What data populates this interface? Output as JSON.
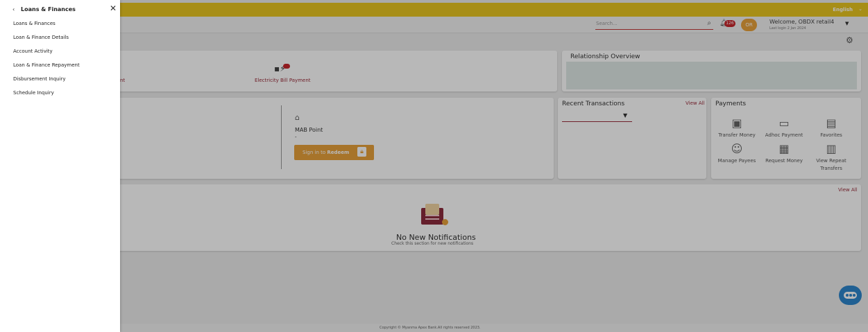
{
  "topbar": {
    "language": "English",
    "language_caret": "⌄"
  },
  "header": {
    "search_placeholder": "Search...",
    "notifications_count": "126",
    "avatar_initials": "OR",
    "welcome": "Welcome, OBDX retail4",
    "last_login": "Last login 2 Jan 2024"
  },
  "quick_access": {
    "partial_label": "nt",
    "electricity_label": "Electricity Bill Payment"
  },
  "relationship": {
    "title": "Relationship Overview"
  },
  "points": {
    "mab_label": "MAB Point",
    "mab_value": "-",
    "redeem_prefix": "Sign in to",
    "redeem_bold": "Redeem"
  },
  "recent": {
    "title": "Recent Transactions",
    "view_all": "View All"
  },
  "payments": {
    "title": "Payments",
    "items": [
      {
        "label": "Transfer Money",
        "icon": "transfer-icon"
      },
      {
        "label": "Adhoc Payment",
        "icon": "card-icon"
      },
      {
        "label": "Favorites",
        "icon": "favorites-icon"
      },
      {
        "label": "Manage Payees",
        "icon": "payees-icon"
      },
      {
        "label": "Request Money",
        "icon": "request-money-icon"
      },
      {
        "label": "View Repeat Transfers",
        "icon": "repeat-transfer-icon"
      }
    ]
  },
  "notifications": {
    "view_all": "View All",
    "title": "No New Notifications",
    "subtitle": "Check this section for new notifications"
  },
  "footer": {
    "copyright": "Copyright © Myanma Apex Bank.All rights reserved 2023."
  },
  "sidemenu": {
    "back": "‹",
    "title": "Loans & Finances",
    "close": "✕",
    "items": [
      "Loans & Finances",
      "Loan & Finance Details",
      "Account Activity",
      "Loan & Finance Repayment",
      "Disbursement Inquiry",
      "Schedule Inquiry"
    ]
  },
  "colors": {
    "brand_yellow": "#e8c521",
    "accent": "#9a2b3a",
    "button": "#e8a13b"
  }
}
